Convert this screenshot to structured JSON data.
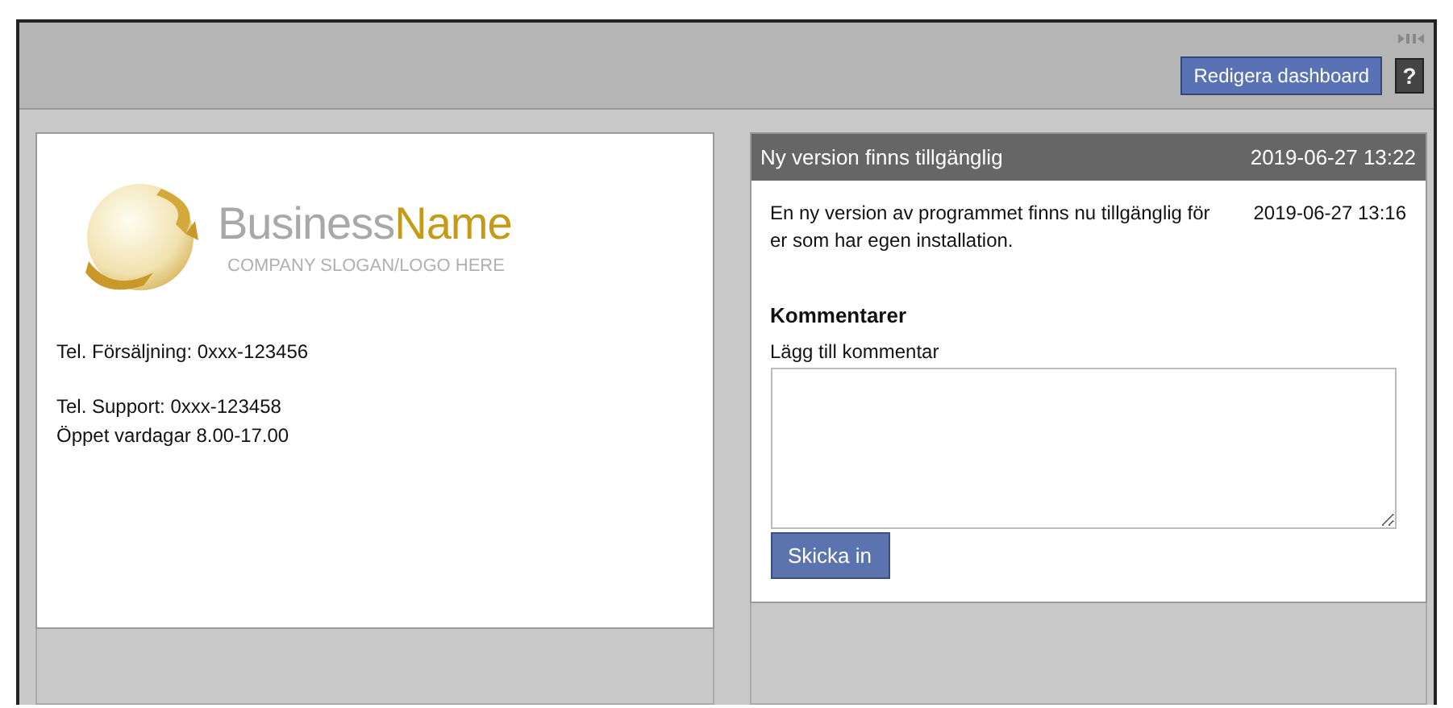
{
  "toolbar": {
    "edit_button": "Redigera dashboard",
    "help_icon": "?"
  },
  "logo": {
    "name_part1": "Business",
    "name_part2": "Name",
    "slogan": "COMPANY SLOGAN/LOGO HERE"
  },
  "contact_groups": [
    [
      "Tel. Försäljning: 0xxx-123456"
    ],
    [
      "Tel. Support: 0xxx-123458",
      "Öppet vardagar 8.00-17.00"
    ]
  ],
  "news": {
    "title": "Ny version finns tillgänglig",
    "timestamp": "2019-06-27 13:22",
    "message": "En ny version av programmet finns nu tillgänglig för er som har egen installation.",
    "message_time": "2019-06-27 13:16",
    "comments_heading": "Kommentarer",
    "comment_label": "Lägg till kommentar",
    "submit_button": "Skicka in"
  }
}
